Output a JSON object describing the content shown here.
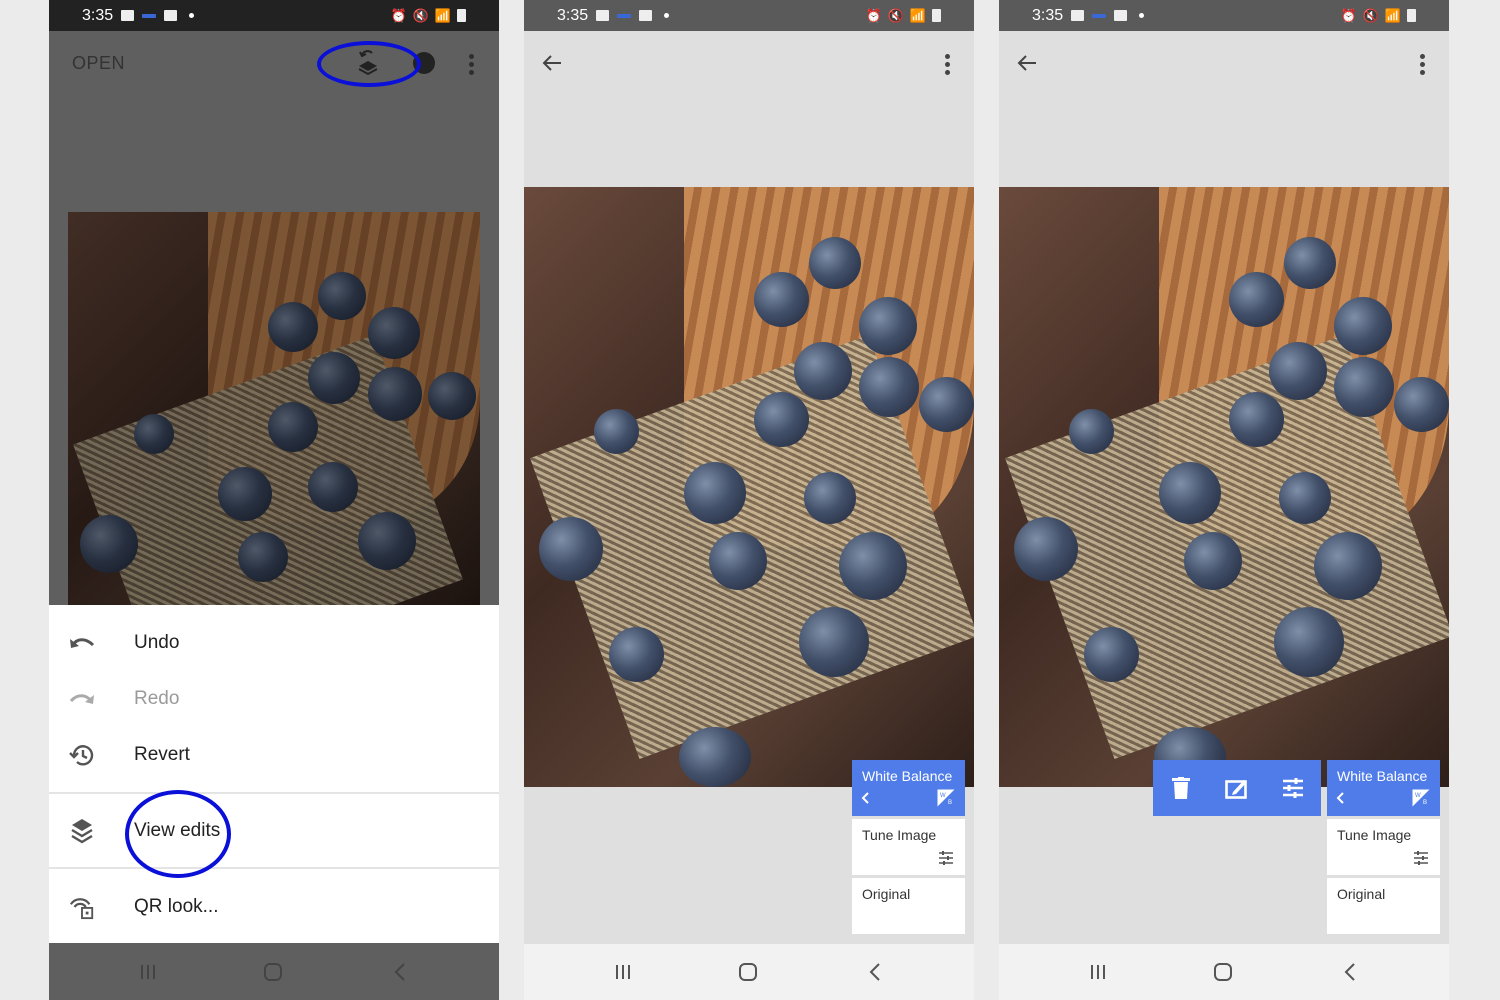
{
  "status_bar": {
    "time": "3:35"
  },
  "panel1": {
    "app_bar": {
      "open_label": "OPEN"
    },
    "menu": {
      "items": [
        {
          "label": "Undo",
          "icon": "undo-icon",
          "enabled": true
        },
        {
          "label": "Redo",
          "icon": "redo-icon",
          "enabled": false
        },
        {
          "label": "Revert",
          "icon": "history-icon",
          "enabled": true
        },
        {
          "label": "View edits",
          "icon": "layers-icon",
          "enabled": true
        },
        {
          "label": "QR look...",
          "icon": "qr-look-icon",
          "enabled": true
        }
      ]
    },
    "annotations": [
      "edit-stack-button-highlight",
      "view-edits-highlight"
    ]
  },
  "panel2": {
    "edit_stack": [
      {
        "title": "White Balance",
        "active": true,
        "icon": "white-balance-icon"
      },
      {
        "title": "Tune Image",
        "active": false,
        "icon": "tune-icon"
      },
      {
        "title": "Original",
        "active": false
      }
    ]
  },
  "panel3": {
    "edit_stack": [
      {
        "title": "White Balance",
        "active": true,
        "icon": "white-balance-icon"
      },
      {
        "title": "Tune Image",
        "active": false,
        "icon": "tune-icon"
      },
      {
        "title": "Original",
        "active": false
      }
    ],
    "toolbar": [
      "delete-icon",
      "brush-edit-icon",
      "tune-sliders-icon"
    ]
  },
  "colors": {
    "accent": "#4f7ce8",
    "annotation": "#0a10d8"
  }
}
